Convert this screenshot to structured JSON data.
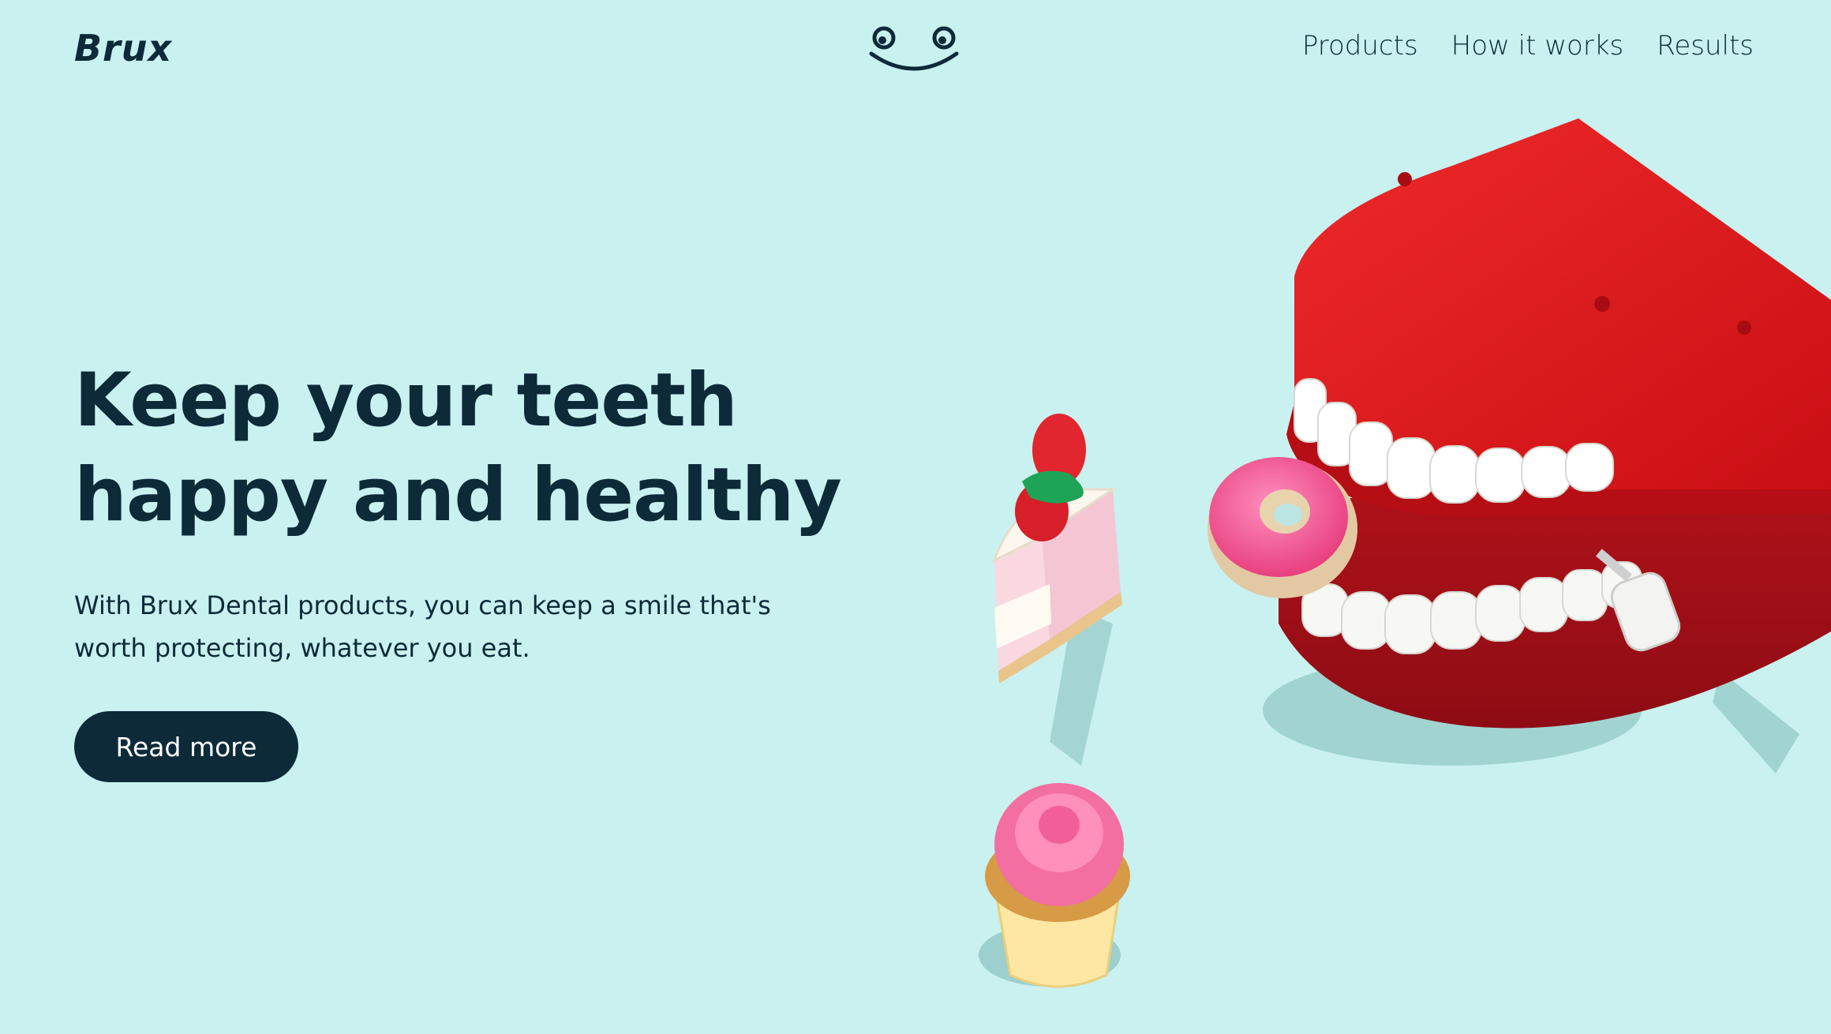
{
  "brand": {
    "name": "Brux"
  },
  "nav": {
    "items": [
      {
        "label": "Products"
      },
      {
        "label": "How it works"
      },
      {
        "label": "Results"
      }
    ]
  },
  "hero": {
    "headline_line1": "Keep your teeth",
    "headline_line2": "happy and healthy",
    "description_line1": "With Brux Dental products, you can keep a smile that's",
    "description_line2": "worth protecting, whatever you eat.",
    "cta_label": "Read more"
  },
  "icons": {
    "mascot": "smiley-face-icon"
  },
  "colors": {
    "background": "#c9f1ef",
    "text": "#0d2a39",
    "button_bg": "#0d2a39",
    "button_text": "#ffffff",
    "teeth_red": "#e01a1f",
    "donut_pink": "#f2589a",
    "cupcake_pink": "#f06b9f"
  }
}
